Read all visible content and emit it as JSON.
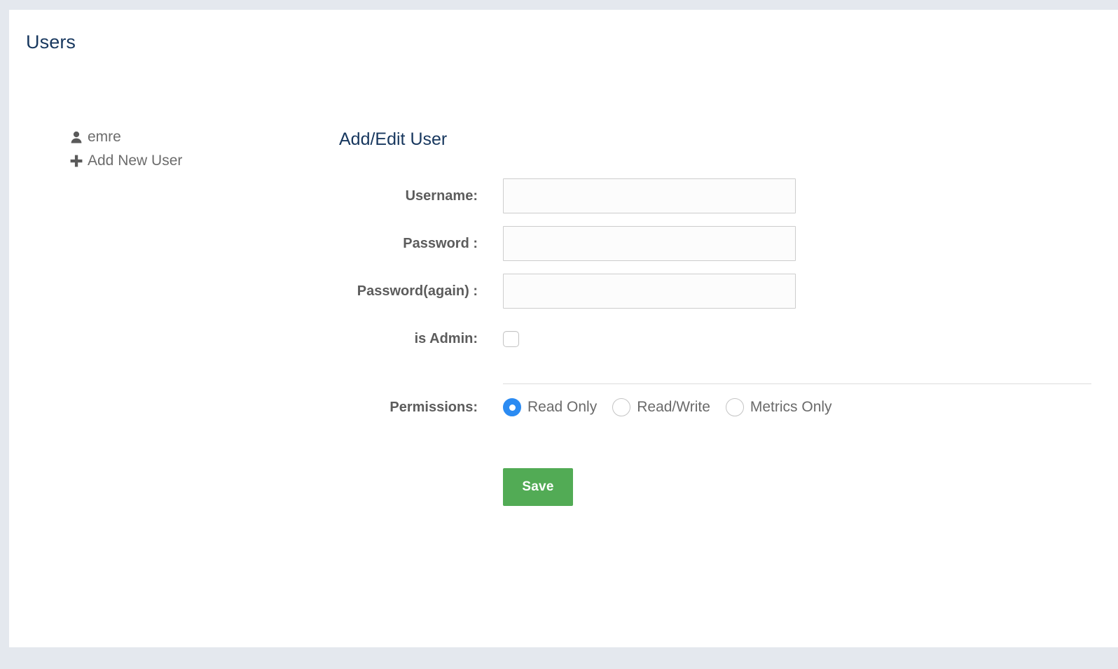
{
  "page": {
    "title": "Users",
    "accent_navy": "#17375e",
    "background": "#e4e8ee",
    "panel_background": "#ffffff"
  },
  "user_list": {
    "items": [
      {
        "label": "emre",
        "icon": "user-icon"
      },
      {
        "label": "Add New User",
        "icon": "plus-icon"
      }
    ]
  },
  "form": {
    "title": "Add/Edit User",
    "fields": {
      "username": {
        "label": "Username:",
        "value": "",
        "placeholder": ""
      },
      "password": {
        "label": "Password :",
        "value": "",
        "placeholder": ""
      },
      "password_again": {
        "label": "Password(again) :",
        "value": "",
        "placeholder": ""
      },
      "is_admin": {
        "label": "is Admin:",
        "checked": false
      },
      "permissions": {
        "label": "Permissions:",
        "selected": "Read Only",
        "options": [
          "Read Only",
          "Read/Write",
          "Metrics Only"
        ],
        "selected_color": "#2b8bf2"
      }
    },
    "save": {
      "label": "Save",
      "color": "#52ab55"
    }
  }
}
